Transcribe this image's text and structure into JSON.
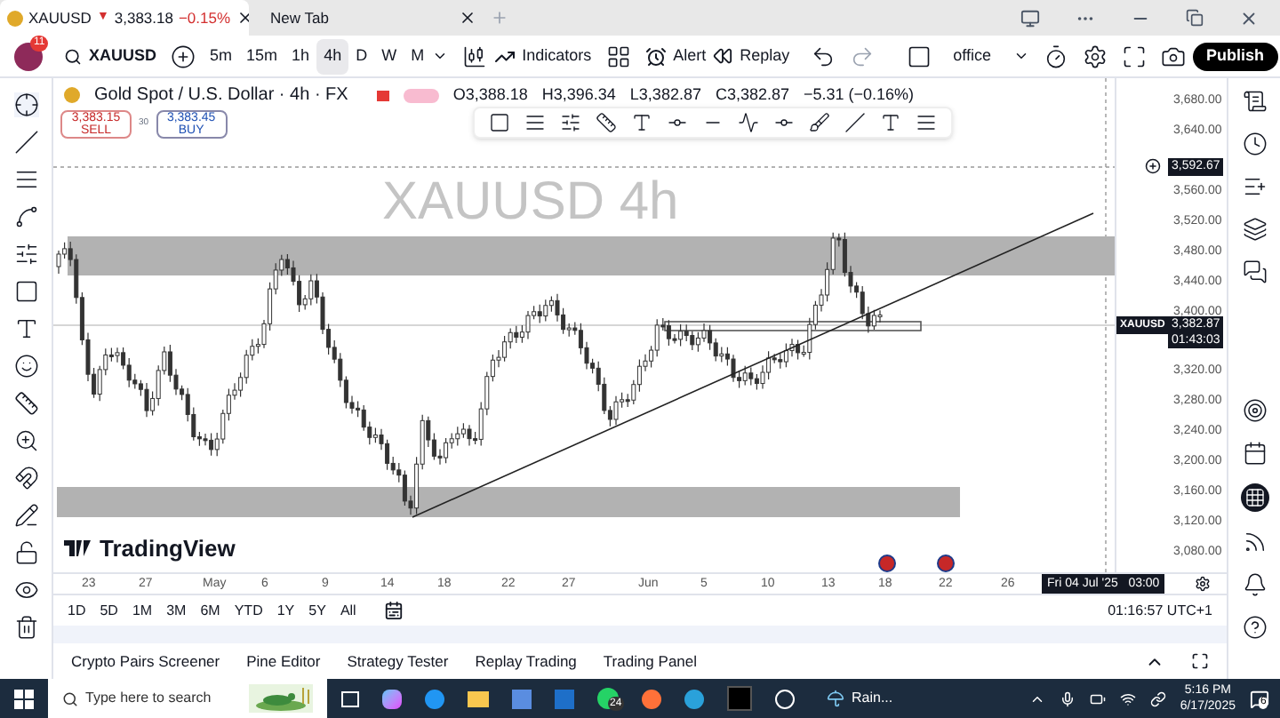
{
  "browser_tabs": [
    {
      "symbol": "XAUUSD",
      "arrow": "▼",
      "price": "3,383.18",
      "change": "−0.15%",
      "selected": true
    },
    {
      "title": "New Tab",
      "selected": false
    }
  ],
  "toolbar": {
    "avatar_badge": "11",
    "symbol": "XAUUSD",
    "intervals": [
      {
        "label": "5m",
        "selected": false
      },
      {
        "label": "15m",
        "selected": false
      },
      {
        "label": "1h",
        "selected": false
      },
      {
        "label": "4h",
        "selected": true
      },
      {
        "label": "D",
        "selected": false
      },
      {
        "label": "W",
        "selected": false
      },
      {
        "label": "M",
        "selected": false
      }
    ],
    "indicators": "Indicators",
    "alert": "Alert",
    "replay": "Replay",
    "layout_name": "office",
    "publish": "Publish"
  },
  "legend": {
    "title": "Gold Spot / U.S. Dollar · 4h · FX",
    "open": "O3,388.18",
    "high": "H3,396.34",
    "low": "L3,382.87",
    "close": "C3,382.87",
    "change": "−5.31 (−0.16%)",
    "sell_price": "3,383.15",
    "sell_label": "SELL",
    "spread": "30",
    "buy_price": "3,383.45",
    "buy_label": "BUY"
  },
  "watermark": "XAUUSD 4h",
  "price_axis": {
    "ticks": [
      "3,680.00",
      "3,640.00",
      "3,560.00",
      "3,520.00",
      "3,480.00",
      "3,440.00",
      "3,400.00",
      "3,320.00",
      "3,280.00",
      "3,240.00",
      "3,200.00",
      "3,160.00",
      "3,120.00",
      "3,080.00"
    ],
    "crosshair_price": "3,592.67",
    "symbol_tag": "XAUUSD",
    "last_price": "3,382.87",
    "countdown": "01:43:03"
  },
  "branding": "TradingView",
  "time_axis": {
    "labels": [
      "23",
      "27",
      "May",
      "6",
      "9",
      "14",
      "18",
      "22",
      "27",
      "Jun",
      "5",
      "10",
      "13",
      "18",
      "22",
      "26"
    ],
    "crosshair_time": "Fri 04 Jul '25   03:00"
  },
  "ranges": [
    "1D",
    "5D",
    "1M",
    "3M",
    "6M",
    "YTD",
    "1Y",
    "5Y",
    "All"
  ],
  "clock": "01:16:57 UTC+1",
  "bottom_tabs": [
    "Crypto Pairs Screener",
    "Pine Editor",
    "Strategy Tester",
    "Replay Trading",
    "Trading Panel"
  ],
  "taskbar": {
    "search_placeholder": "Type here to search",
    "whatsapp_badge": "24",
    "weather": "Rain...",
    "time": "5:16 PM",
    "date": "6/17/2025",
    "notifications": "6"
  }
}
